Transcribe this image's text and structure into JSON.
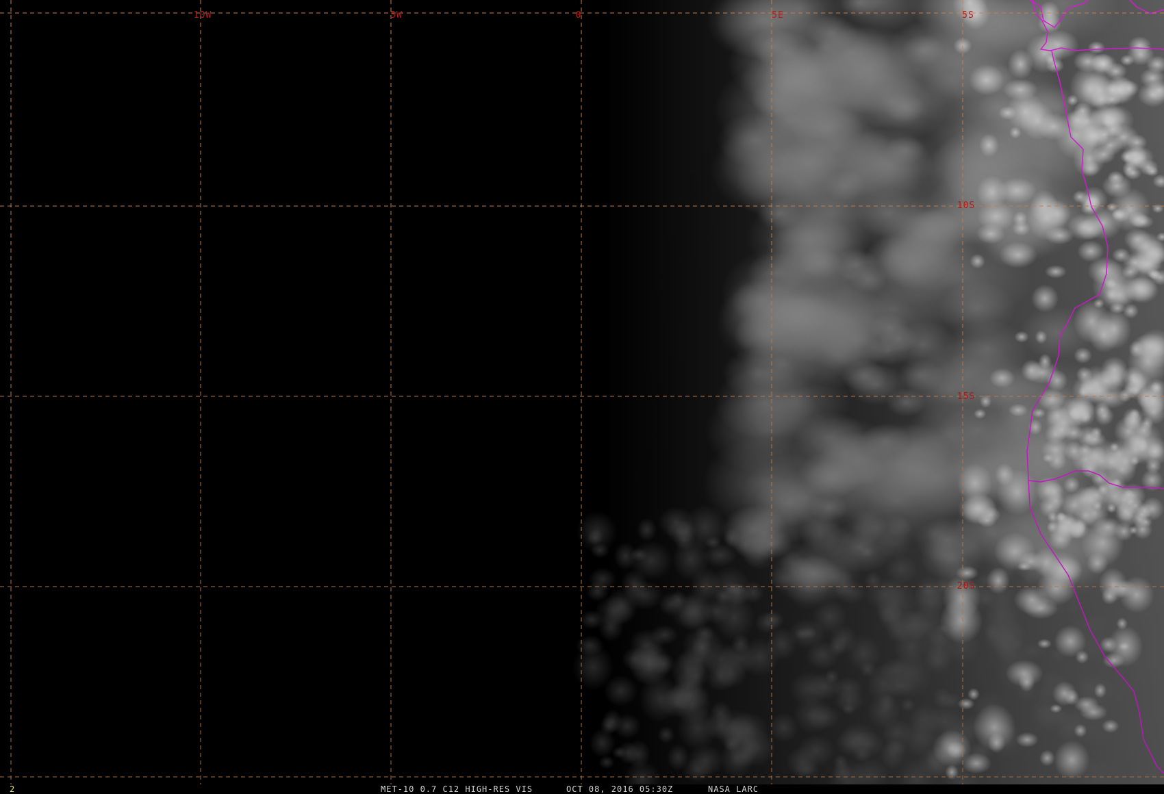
{
  "map": {
    "longitude_labels": [
      "10W",
      "5W",
      "0",
      "5E",
      "5S"
    ],
    "latitude_labels": [
      "10S",
      "15S",
      "20S"
    ],
    "colors": {
      "background": "#000000",
      "graticule": "#c8824c",
      "grid_label": "#c01818",
      "coastline": "#d41cd4",
      "cloud_light": "#e6e6e6",
      "cloud_dark": "#3a3a3a",
      "ocean_dark": "#1a1a1a"
    }
  },
  "status": {
    "frame": "2",
    "product": "MET-10 0.7 C12 HIGH-RES VIS",
    "datetime": "OCT 08, 2016 05:30Z",
    "source": "NASA LARC"
  }
}
